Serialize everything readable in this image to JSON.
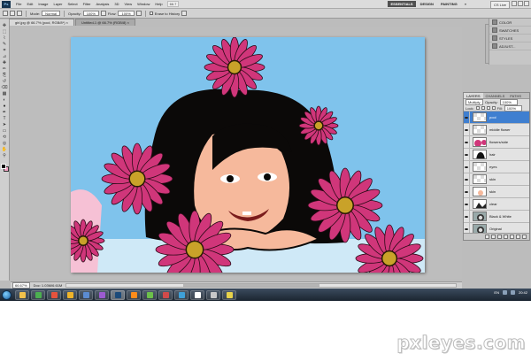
{
  "app": {
    "logo_text": "Ps"
  },
  "menubar": {
    "items": [
      "File",
      "Edit",
      "Image",
      "Layer",
      "Select",
      "Filter",
      "Analysis",
      "3D",
      "View",
      "Window",
      "Help"
    ],
    "zoom": "66.7",
    "workspaces": [
      "ESSENTIALS",
      "DESIGN",
      "PAINTING"
    ],
    "active_workspace": "ESSENTIALS",
    "more": "»",
    "cs_live": "CS Live"
  },
  "options": {
    "mode_label": "Mode:",
    "mode_value": "Normal",
    "opacity_label": "Opacity:",
    "opacity_value": "100%",
    "flow_label": "Flow:",
    "flow_value": "100%",
    "erase_label": "Erase to History"
  },
  "tabs": [
    {
      "label": "girl.jpg @ 66.7% (pool, RGB/8*) ×",
      "active": true
    },
    {
      "label": "Untitled-1 @ 66.7% (RGB/8) ×",
      "active": false
    }
  ],
  "toolbox": {
    "tools": [
      "move-tool",
      "marquee-tool",
      "lasso-tool",
      "quick-select-tool",
      "crop-tool",
      "eyedropper-tool",
      "healing-tool",
      "brush-tool",
      "clone-tool",
      "history-brush-tool",
      "eraser-tool",
      "gradient-tool",
      "blur-tool",
      "dodge-tool",
      "pen-tool",
      "type-tool",
      "path-select-tool",
      "shape-tool",
      "3d-rotate-tool",
      "3d-orbit-tool",
      "hand-tool",
      "zoom-tool"
    ],
    "foreground": "#000000",
    "background": "#f4a3c4"
  },
  "status": {
    "zoom": "66.67%",
    "doc_info": "Doc: 1.03M/6.61M"
  },
  "dock": {
    "items": [
      "COLOR",
      "SWATCHES",
      "STYLES",
      "ADJUST..."
    ]
  },
  "layers_panel": {
    "tabs": [
      "LAYERS",
      "CHANNELS",
      "PATHS"
    ],
    "blend_mode": "Multiply",
    "opacity_label": "Opacity:",
    "opacity_value": "100%",
    "lock_label": "Lock:",
    "fill_label": "Fill:",
    "fill_value": "100%",
    "layers": [
      {
        "name": "pool",
        "selected": true,
        "thumb": "blank"
      },
      {
        "name": "middle flower",
        "selected": false,
        "thumb": "blank"
      },
      {
        "name": "flowers/side",
        "selected": false,
        "thumb": "flower"
      },
      {
        "name": "hair",
        "selected": false,
        "thumb": "hair"
      },
      {
        "name": "eyes",
        "selected": false,
        "thumb": "blank"
      },
      {
        "name": "skin",
        "selected": false,
        "thumb": "blank"
      },
      {
        "name": "skin",
        "selected": false,
        "thumb": "skin"
      },
      {
        "name": "clear",
        "selected": false,
        "thumb": "dark"
      },
      {
        "name": "Black & White",
        "selected": false,
        "thumb": "girl"
      },
      {
        "name": "Original",
        "selected": false,
        "thumb": "girl"
      }
    ]
  },
  "taskbar": {
    "apps": [
      "explorer",
      "chrome",
      "media",
      "folder",
      "app5",
      "app6",
      "photoshop",
      "app8",
      "app9",
      "app10",
      "app11",
      "app12",
      "app13",
      "app14"
    ],
    "active_app": "photoshop",
    "colors": [
      "#f2c14b",
      "#4caf50",
      "#e5533d",
      "#f0b429",
      "#5b8bd0",
      "#9c5bd0",
      "#1b4a7a",
      "#ff8c1a",
      "#6cc04a",
      "#d04a4a",
      "#3ea0d8",
      "#ffffff",
      "#c8c8c8",
      "#e7d24a"
    ],
    "lang": "EN",
    "time": "20:42"
  },
  "canvas": {
    "sky": "#7fc3ec",
    "flower_color": "#d0367a",
    "flower_center": "#c9a229",
    "skin": "#f6b99c"
  },
  "watermark": "pxleyes.com"
}
